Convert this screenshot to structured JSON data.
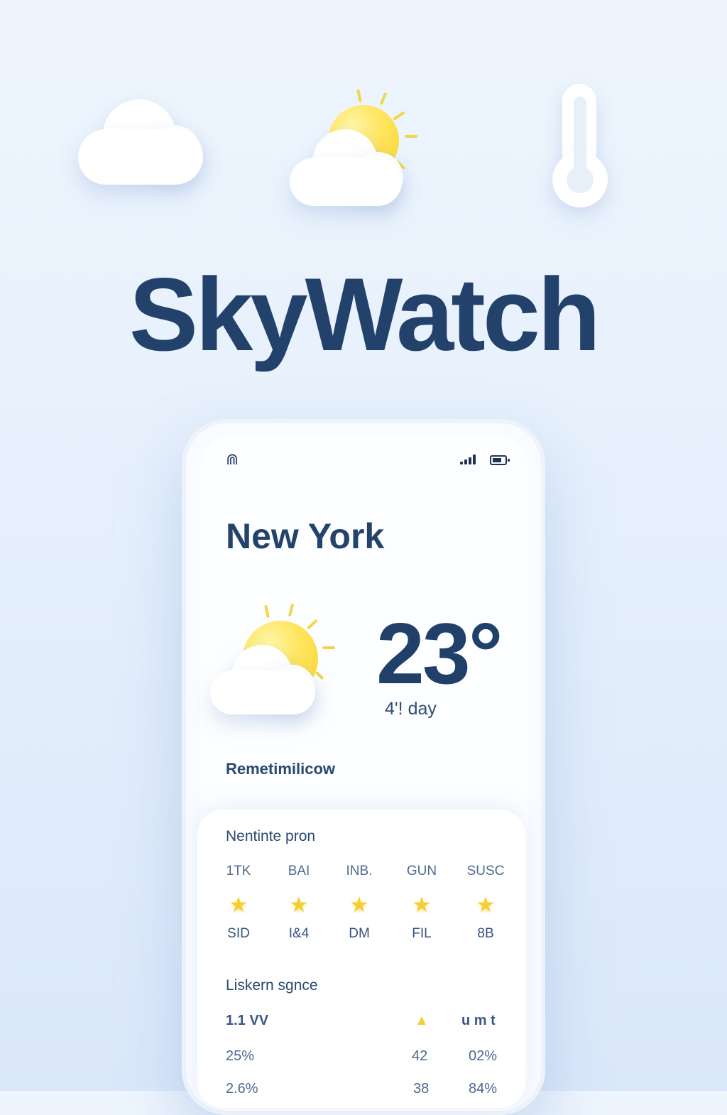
{
  "app": {
    "title": "SkyWatch"
  },
  "status_bar": {
    "left_glyph": "⋒"
  },
  "current": {
    "city": "New York",
    "temperature": "23°",
    "condition": "4'! day"
  },
  "section_label": "Remetimilicow",
  "forecast": {
    "title": "Nentinte pron",
    "days": [
      {
        "day": "1TK",
        "value": "SID"
      },
      {
        "day": "BAI",
        "value": "I&4"
      },
      {
        "day": "INB.",
        "value": "DM"
      },
      {
        "day": "GUN",
        "value": "FIL"
      },
      {
        "day": "SUSC",
        "value": "8B"
      }
    ],
    "icon": "star-icon"
  },
  "details": {
    "title": "Liskern sgnce",
    "header": [
      "1.1 VV",
      "▲",
      "u m t"
    ],
    "rows": [
      [
        "25%",
        "42",
        "02%"
      ],
      [
        "2.6%",
        "38",
        "84%"
      ]
    ]
  },
  "colors": {
    "primary_text": "#22426b",
    "sun_yellow": "#ffe45c",
    "background": "#e6f0fc"
  }
}
